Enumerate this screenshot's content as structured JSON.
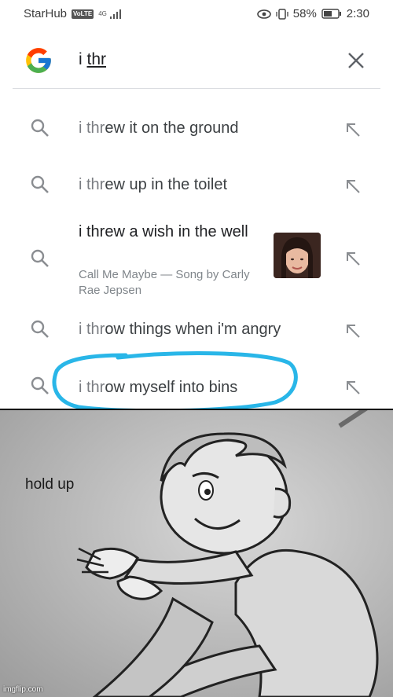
{
  "status_bar": {
    "carrier": "StarHub",
    "volte": "VoLTE",
    "network": "4G",
    "battery": "58%",
    "time": "2:30"
  },
  "search": {
    "query_prefix": "i ",
    "query_typed": "thr"
  },
  "suggestions": [
    {
      "prefix": "i thr",
      "rest": "ew it on the ground"
    },
    {
      "prefix": "i thr",
      "rest": "ew up in the toilet"
    },
    {
      "title": "i threw a wish in the well",
      "subtitle": "Call Me Maybe — Song by Carly Rae Jepsen"
    },
    {
      "prefix": "i thr",
      "rest": "ow things when i'm angry"
    },
    {
      "prefix": "i thr",
      "rest": "ow myself into bins"
    }
  ],
  "meme": {
    "caption": "hold up",
    "watermark": "imgflip.com"
  },
  "colors": {
    "circle_annotation": "#29b6e8",
    "query_text": "#202124",
    "suggestion_text": "#3c4043",
    "suggestion_prefix": "#7a7d82",
    "meme_background": "#bfbfbf"
  }
}
